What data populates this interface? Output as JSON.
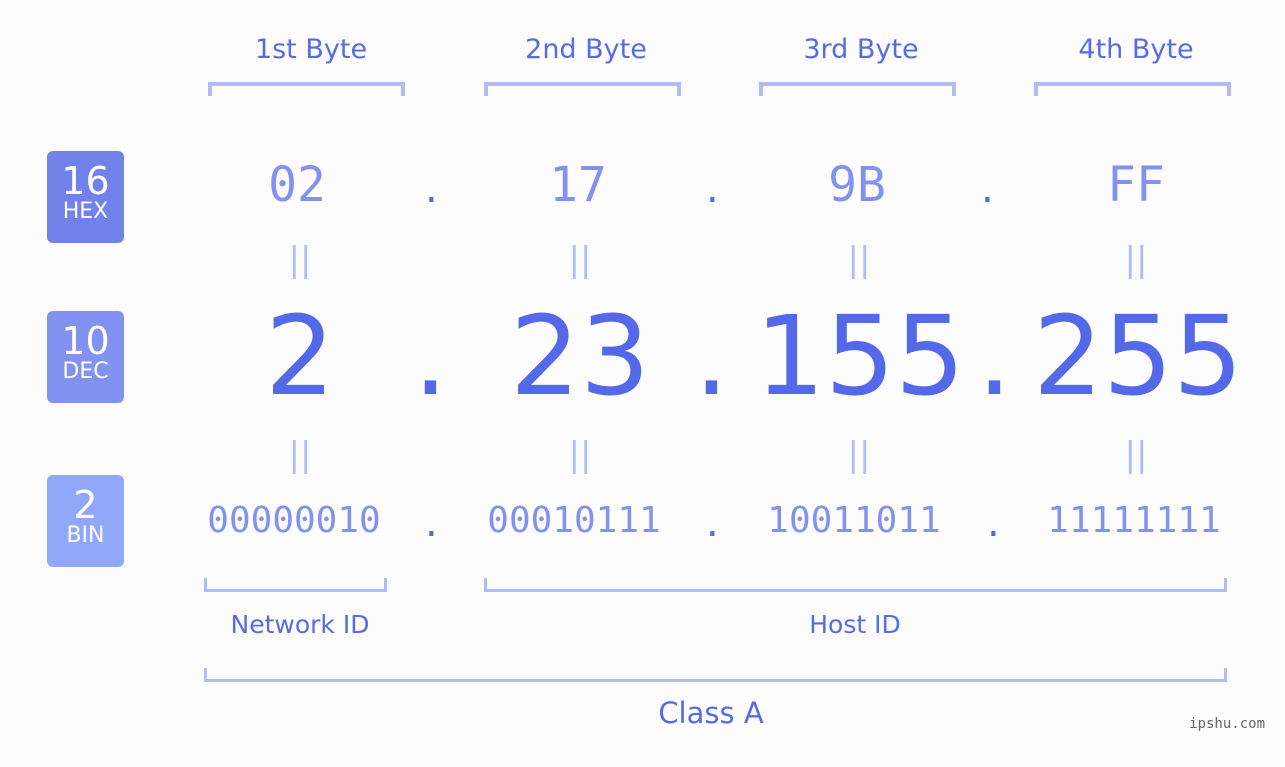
{
  "bytes": {
    "labels": [
      "1st Byte",
      "2nd Byte",
      "3rd Byte",
      "4th Byte"
    ]
  },
  "bases": {
    "hex": {
      "num": "16",
      "label": "HEX",
      "color": "#7381ea"
    },
    "dec": {
      "num": "10",
      "label": "DEC",
      "color": "#8391f0"
    },
    "bin": {
      "num": "2",
      "label": "BIN",
      "color": "#91a8f8"
    }
  },
  "ip": {
    "hex": [
      "02",
      "17",
      "9B",
      "FF"
    ],
    "dec": [
      "2",
      "23",
      "155",
      "255"
    ],
    "bin": [
      "00000010",
      "00010111",
      "10011011",
      "11111111"
    ],
    "separator": ".",
    "equals": "||"
  },
  "groups": {
    "network": "Network ID",
    "host": "Host ID",
    "class": "Class A"
  },
  "watermark": "ipshu.com",
  "colors": {
    "accent": "#5468ea",
    "light": "#8491ee",
    "bracket": "#b3bcf7"
  }
}
